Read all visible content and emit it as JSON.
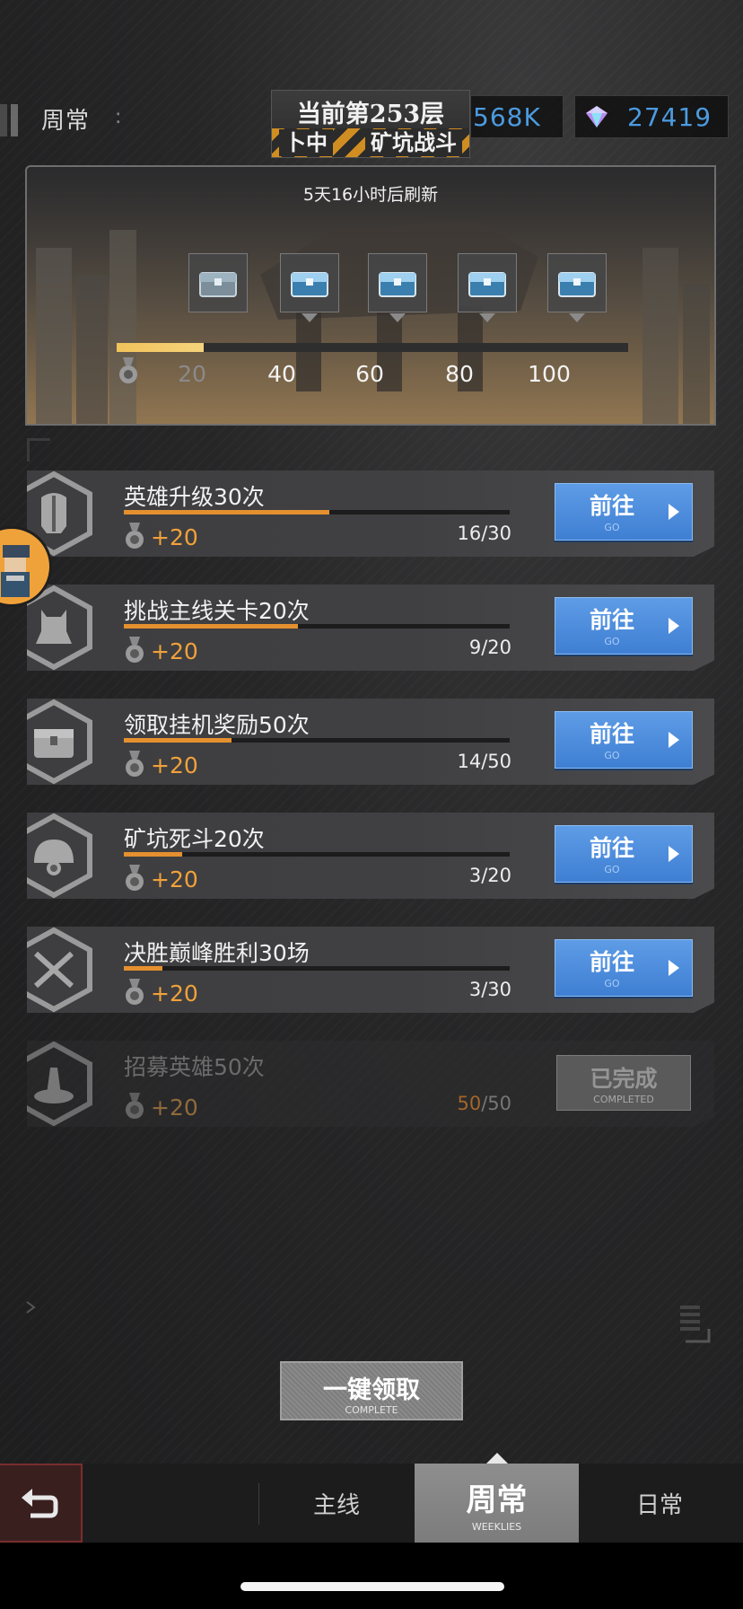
{
  "header": {
    "title": "周常",
    "separator": ":",
    "floor_title": "当前第253层",
    "floor_sub_left": "卜中",
    "floor_sub_right": "矿坑战斗",
    "gold_value": "568K",
    "gem_value": "27419"
  },
  "rewards": {
    "refresh_text": "5天16小时后刷新",
    "progress_fraction": 0.17,
    "milestones": [
      "20",
      "40",
      "60",
      "80",
      "100"
    ]
  },
  "quests": [
    {
      "title": "英雄升级30次",
      "reward": "+20",
      "progress": "16/30",
      "fraction": 0.533,
      "btn": "前往",
      "btn_sub": "GO"
    },
    {
      "title": "挑战主线关卡20次",
      "reward": "+20",
      "progress": "9/20",
      "fraction": 0.45,
      "btn": "前往",
      "btn_sub": "GO"
    },
    {
      "title": "领取挂机奖励50次",
      "reward": "+20",
      "progress": "14/50",
      "fraction": 0.28,
      "btn": "前往",
      "btn_sub": "GO"
    },
    {
      "title": "矿坑死斗20次",
      "reward": "+20",
      "progress": "3/20",
      "fraction": 0.15,
      "btn": "前往",
      "btn_sub": "GO"
    },
    {
      "title": "决胜巅峰胜利30场",
      "reward": "+20",
      "progress": "3/30",
      "fraction": 0.1,
      "btn": "前往",
      "btn_sub": "GO"
    },
    {
      "title": "招募英雄50次",
      "reward": "+20",
      "progress_cur": "50",
      "progress_total": "/50",
      "fraction": 1.0,
      "btn": "已完成",
      "btn_sub": "COMPLETED"
    }
  ],
  "claim_all": {
    "label": "一键领取",
    "sub": "COMPLETE"
  },
  "nav": {
    "main": "主线",
    "weekly": "周常",
    "weekly_sub": "WEEKLIES",
    "daily": "日常"
  },
  "colors": {
    "accent_blue": "#4b9be0",
    "reward_orange": "#f0a13b",
    "progress_yellow": "#f2c35a"
  },
  "icons": [
    "gem-icon",
    "chest-icon",
    "medal-icon",
    "helmet-icon",
    "monster-icon",
    "treasure-icon",
    "mine-icon",
    "swords-icon",
    "summon-icon",
    "back-arrow-icon"
  ]
}
